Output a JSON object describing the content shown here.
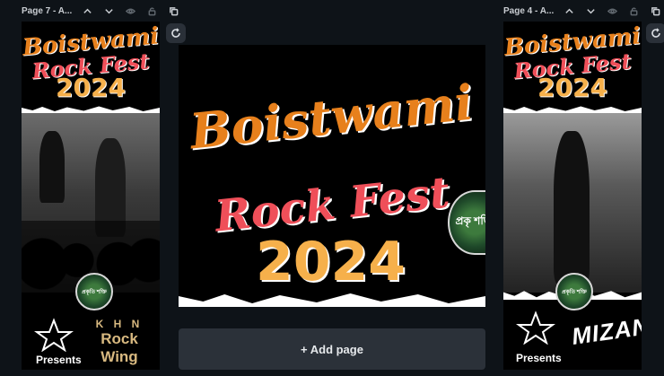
{
  "left_page": {
    "label": "Page 7 - A...",
    "title_line1": "Boistwami",
    "title_line2": "Rock Fest",
    "title_year": "2024",
    "badge_text": "প্রকৃতি শক্তি",
    "band_line1": "K H N",
    "band_line2": "Rock Wing",
    "presents": "Presents"
  },
  "right_page": {
    "label": "Page 4 - A...",
    "title_line1": "Boistwami",
    "title_line2": "Rock Fest",
    "title_year": "2024",
    "badge_text": "প্রকৃতি শক্তি",
    "artist": "MIZAN",
    "presents": "Presents"
  },
  "center_page": {
    "title_line1": "Boistwami",
    "title_line2": "Rock Fest",
    "title_year": "2024",
    "badge_text": "প্রকৃ শক্তি"
  },
  "add_page": {
    "label": "+ Add page"
  },
  "icons": [
    "chevron-up-icon",
    "chevron-down-icon",
    "eye-icon",
    "lock-icon",
    "duplicate-icon",
    "refresh-icon"
  ]
}
